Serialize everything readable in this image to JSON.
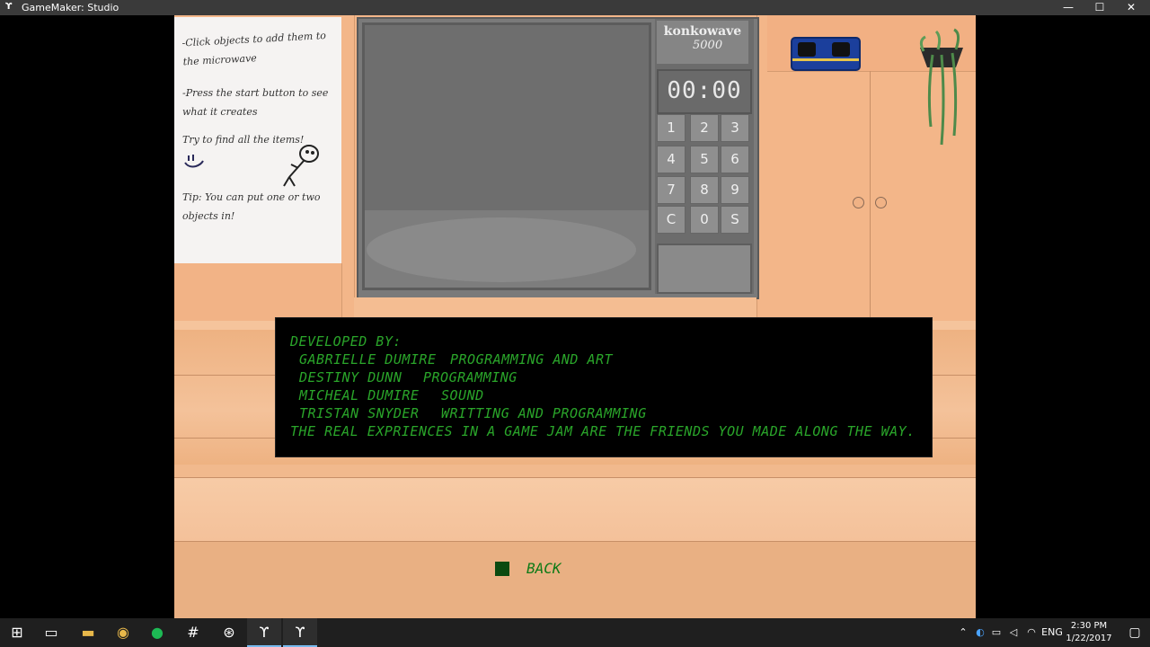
{
  "window": {
    "app_icon": "gamemaker-icon",
    "title": "GameMaker: Studio",
    "minimize": "—",
    "maximize": "☐",
    "close": "✕"
  },
  "note": {
    "line1": "-Click objects to add them to the microwave",
    "line2": "-Press the start button to see what it creates",
    "line3": "Try to find all the items!",
    "line4": "Tip: You can put one or two objects in!"
  },
  "microwave": {
    "brand": "konkowave",
    "model": "5000",
    "display": "00:00",
    "keys": [
      "1",
      "2",
      "3",
      "4",
      "5",
      "6",
      "7",
      "8",
      "9",
      "C",
      "0",
      "S"
    ]
  },
  "credits": {
    "heading": "DEVELOPED BY:",
    "entries": [
      {
        "name": "GABRIELLE DUMIRE",
        "role": "PROGRAMMING AND ART"
      },
      {
        "name": "DESTINY DUNN",
        "role": "PROGRAMMING"
      },
      {
        "name": "MICHEAL DUMIRE",
        "role": "SOUND"
      },
      {
        "name": "TRISTAN SNYDER",
        "role": "WRITTING AND PROGRAMMING"
      }
    ],
    "footer": "THE REAL EXPRIENCES IN A GAME JAM ARE THE FRIENDS YOU MADE ALONG THE WAY."
  },
  "back_button": {
    "label": "BACK"
  },
  "taskbar": {
    "icons": [
      "windows-start-icon",
      "task-view-icon",
      "file-explorer-icon",
      "chrome-icon",
      "spotify-icon",
      "slack-icon",
      "steam-icon",
      "gamemaker-icon",
      "gamemaker-icon"
    ],
    "tray": {
      "language": "ENG"
    },
    "clock": {
      "time": "2:30 PM",
      "date": "1/22/2017"
    }
  }
}
